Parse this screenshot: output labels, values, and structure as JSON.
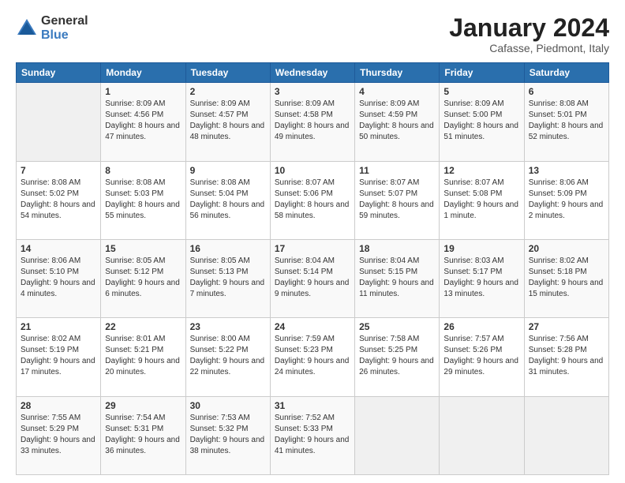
{
  "header": {
    "logo_general": "General",
    "logo_blue": "Blue",
    "month": "January 2024",
    "location": "Cafasse, Piedmont, Italy"
  },
  "weekdays": [
    "Sunday",
    "Monday",
    "Tuesday",
    "Wednesday",
    "Thursday",
    "Friday",
    "Saturday"
  ],
  "weeks": [
    [
      {
        "day": "",
        "sunrise": "",
        "sunset": "",
        "daylight": ""
      },
      {
        "day": "1",
        "sunrise": "Sunrise: 8:09 AM",
        "sunset": "Sunset: 4:56 PM",
        "daylight": "Daylight: 8 hours and 47 minutes."
      },
      {
        "day": "2",
        "sunrise": "Sunrise: 8:09 AM",
        "sunset": "Sunset: 4:57 PM",
        "daylight": "Daylight: 8 hours and 48 minutes."
      },
      {
        "day": "3",
        "sunrise": "Sunrise: 8:09 AM",
        "sunset": "Sunset: 4:58 PM",
        "daylight": "Daylight: 8 hours and 49 minutes."
      },
      {
        "day": "4",
        "sunrise": "Sunrise: 8:09 AM",
        "sunset": "Sunset: 4:59 PM",
        "daylight": "Daylight: 8 hours and 50 minutes."
      },
      {
        "day": "5",
        "sunrise": "Sunrise: 8:09 AM",
        "sunset": "Sunset: 5:00 PM",
        "daylight": "Daylight: 8 hours and 51 minutes."
      },
      {
        "day": "6",
        "sunrise": "Sunrise: 8:08 AM",
        "sunset": "Sunset: 5:01 PM",
        "daylight": "Daylight: 8 hours and 52 minutes."
      }
    ],
    [
      {
        "day": "7",
        "sunrise": "Sunrise: 8:08 AM",
        "sunset": "Sunset: 5:02 PM",
        "daylight": "Daylight: 8 hours and 54 minutes."
      },
      {
        "day": "8",
        "sunrise": "Sunrise: 8:08 AM",
        "sunset": "Sunset: 5:03 PM",
        "daylight": "Daylight: 8 hours and 55 minutes."
      },
      {
        "day": "9",
        "sunrise": "Sunrise: 8:08 AM",
        "sunset": "Sunset: 5:04 PM",
        "daylight": "Daylight: 8 hours and 56 minutes."
      },
      {
        "day": "10",
        "sunrise": "Sunrise: 8:07 AM",
        "sunset": "Sunset: 5:06 PM",
        "daylight": "Daylight: 8 hours and 58 minutes."
      },
      {
        "day": "11",
        "sunrise": "Sunrise: 8:07 AM",
        "sunset": "Sunset: 5:07 PM",
        "daylight": "Daylight: 8 hours and 59 minutes."
      },
      {
        "day": "12",
        "sunrise": "Sunrise: 8:07 AM",
        "sunset": "Sunset: 5:08 PM",
        "daylight": "Daylight: 9 hours and 1 minute."
      },
      {
        "day": "13",
        "sunrise": "Sunrise: 8:06 AM",
        "sunset": "Sunset: 5:09 PM",
        "daylight": "Daylight: 9 hours and 2 minutes."
      }
    ],
    [
      {
        "day": "14",
        "sunrise": "Sunrise: 8:06 AM",
        "sunset": "Sunset: 5:10 PM",
        "daylight": "Daylight: 9 hours and 4 minutes."
      },
      {
        "day": "15",
        "sunrise": "Sunrise: 8:05 AM",
        "sunset": "Sunset: 5:12 PM",
        "daylight": "Daylight: 9 hours and 6 minutes."
      },
      {
        "day": "16",
        "sunrise": "Sunrise: 8:05 AM",
        "sunset": "Sunset: 5:13 PM",
        "daylight": "Daylight: 9 hours and 7 minutes."
      },
      {
        "day": "17",
        "sunrise": "Sunrise: 8:04 AM",
        "sunset": "Sunset: 5:14 PM",
        "daylight": "Daylight: 9 hours and 9 minutes."
      },
      {
        "day": "18",
        "sunrise": "Sunrise: 8:04 AM",
        "sunset": "Sunset: 5:15 PM",
        "daylight": "Daylight: 9 hours and 11 minutes."
      },
      {
        "day": "19",
        "sunrise": "Sunrise: 8:03 AM",
        "sunset": "Sunset: 5:17 PM",
        "daylight": "Daylight: 9 hours and 13 minutes."
      },
      {
        "day": "20",
        "sunrise": "Sunrise: 8:02 AM",
        "sunset": "Sunset: 5:18 PM",
        "daylight": "Daylight: 9 hours and 15 minutes."
      }
    ],
    [
      {
        "day": "21",
        "sunrise": "Sunrise: 8:02 AM",
        "sunset": "Sunset: 5:19 PM",
        "daylight": "Daylight: 9 hours and 17 minutes."
      },
      {
        "day": "22",
        "sunrise": "Sunrise: 8:01 AM",
        "sunset": "Sunset: 5:21 PM",
        "daylight": "Daylight: 9 hours and 20 minutes."
      },
      {
        "day": "23",
        "sunrise": "Sunrise: 8:00 AM",
        "sunset": "Sunset: 5:22 PM",
        "daylight": "Daylight: 9 hours and 22 minutes."
      },
      {
        "day": "24",
        "sunrise": "Sunrise: 7:59 AM",
        "sunset": "Sunset: 5:23 PM",
        "daylight": "Daylight: 9 hours and 24 minutes."
      },
      {
        "day": "25",
        "sunrise": "Sunrise: 7:58 AM",
        "sunset": "Sunset: 5:25 PM",
        "daylight": "Daylight: 9 hours and 26 minutes."
      },
      {
        "day": "26",
        "sunrise": "Sunrise: 7:57 AM",
        "sunset": "Sunset: 5:26 PM",
        "daylight": "Daylight: 9 hours and 29 minutes."
      },
      {
        "day": "27",
        "sunrise": "Sunrise: 7:56 AM",
        "sunset": "Sunset: 5:28 PM",
        "daylight": "Daylight: 9 hours and 31 minutes."
      }
    ],
    [
      {
        "day": "28",
        "sunrise": "Sunrise: 7:55 AM",
        "sunset": "Sunset: 5:29 PM",
        "daylight": "Daylight: 9 hours and 33 minutes."
      },
      {
        "day": "29",
        "sunrise": "Sunrise: 7:54 AM",
        "sunset": "Sunset: 5:31 PM",
        "daylight": "Daylight: 9 hours and 36 minutes."
      },
      {
        "day": "30",
        "sunrise": "Sunrise: 7:53 AM",
        "sunset": "Sunset: 5:32 PM",
        "daylight": "Daylight: 9 hours and 38 minutes."
      },
      {
        "day": "31",
        "sunrise": "Sunrise: 7:52 AM",
        "sunset": "Sunset: 5:33 PM",
        "daylight": "Daylight: 9 hours and 41 minutes."
      },
      {
        "day": "",
        "sunrise": "",
        "sunset": "",
        "daylight": ""
      },
      {
        "day": "",
        "sunrise": "",
        "sunset": "",
        "daylight": ""
      },
      {
        "day": "",
        "sunrise": "",
        "sunset": "",
        "daylight": ""
      }
    ]
  ]
}
